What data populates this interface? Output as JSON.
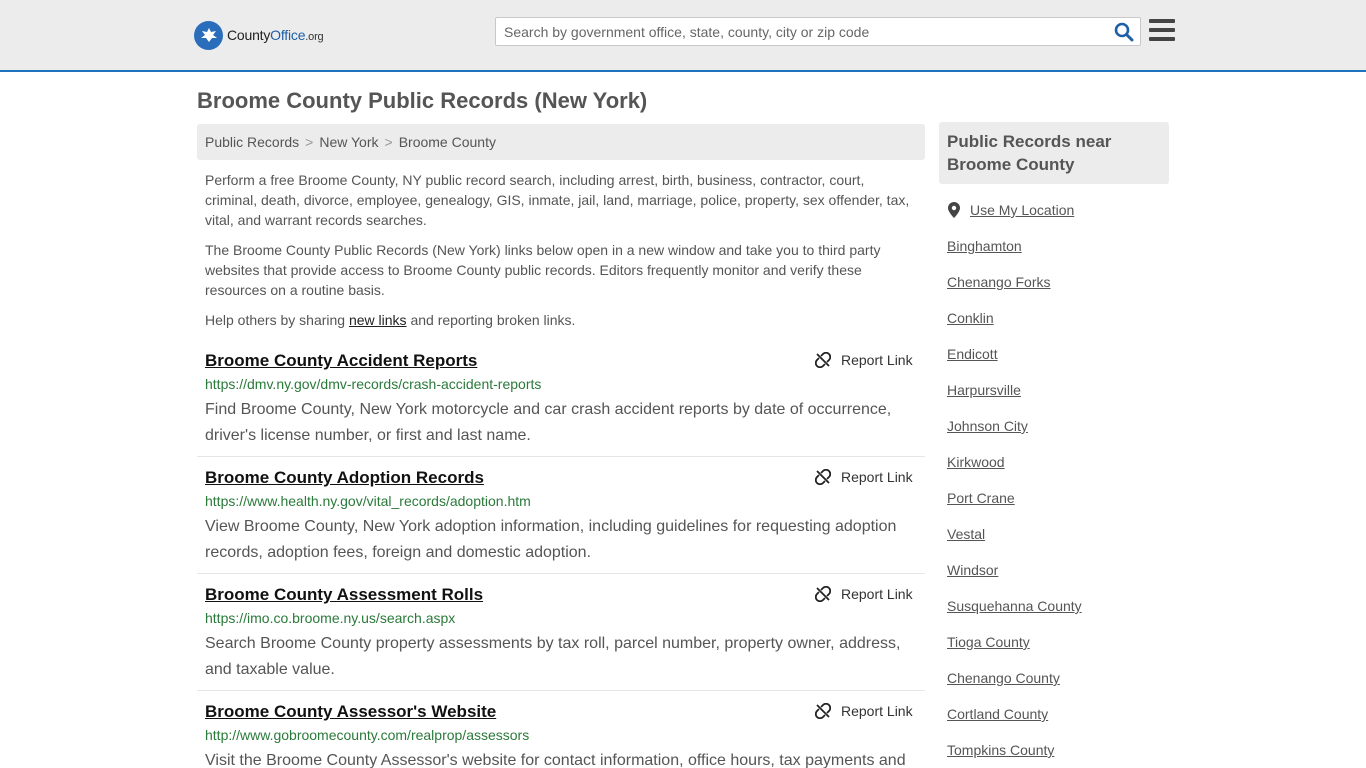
{
  "header": {
    "logo": {
      "part1": "County",
      "part2": "Office",
      "part3": ".org"
    },
    "search_placeholder": "Search by government office, state, county, city or zip code"
  },
  "page_title": "Broome County Public Records (New York)",
  "breadcrumb": [
    "Public Records",
    "New York",
    "Broome County"
  ],
  "breadcrumb_separator": ">",
  "intro": {
    "p1": "Perform a free Broome County, NY public record search, including arrest, birth, business, contractor, court, criminal, death, divorce, employee, genealogy, GIS, inmate, jail, land, marriage, police, property, sex offender, tax, vital, and warrant records searches.",
    "p2": "The Broome County Public Records (New York) links below open in a new window and take you to third party websites that provide access to Broome County public records. Editors frequently monitor and verify these resources on a routine basis.",
    "p3_before": "Help others by sharing ",
    "p3_link": "new links",
    "p3_after": " and reporting broken links."
  },
  "report_label": "Report Link",
  "records": [
    {
      "title": "Broome County Accident Reports",
      "url": "https://dmv.ny.gov/dmv-records/crash-accident-reports",
      "desc": "Find Broome County, New York motorcycle and car crash accident reports by date of occurrence, driver's license number, or first and last name."
    },
    {
      "title": "Broome County Adoption Records",
      "url": "https://www.health.ny.gov/vital_records/adoption.htm",
      "desc": "View Broome County, New York adoption information, including guidelines for requesting adoption records, adoption fees, foreign and domestic adoption."
    },
    {
      "title": "Broome County Assessment Rolls",
      "url": "https://imo.co.broome.ny.us/search.aspx",
      "desc": "Search Broome County property assessments by tax roll, parcel number, property owner, address, and taxable value."
    },
    {
      "title": "Broome County Assessor's Website",
      "url": "http://www.gobroomecounty.com/realprop/assessors",
      "desc": "Visit the Broome County Assessor's website for contact information, office hours, tax payments and"
    }
  ],
  "sidebar": {
    "heading": "Public Records near Broome County",
    "use_location": "Use My Location",
    "links": [
      "Binghamton",
      "Chenango Forks",
      "Conklin",
      "Endicott",
      "Harpursville",
      "Johnson City",
      "Kirkwood",
      "Port Crane",
      "Vestal",
      "Windsor",
      "Susquehanna County",
      "Tioga County",
      "Chenango County",
      "Cortland County",
      "Tompkins County"
    ]
  },
  "colors": {
    "accent": "#1e73be",
    "url_green": "#2a7a3a",
    "panel_gray": "#ececec"
  }
}
